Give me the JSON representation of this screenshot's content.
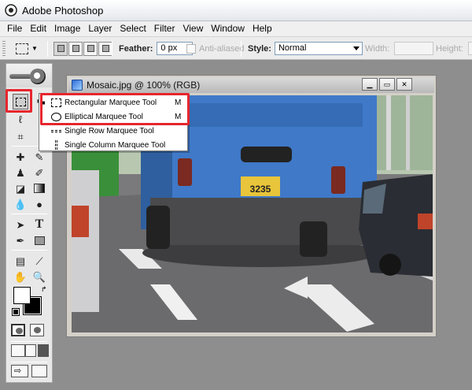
{
  "app": {
    "title": "Adobe Photoshop"
  },
  "menu": [
    "File",
    "Edit",
    "Image",
    "Layer",
    "Select",
    "Filter",
    "View",
    "Window",
    "Help"
  ],
  "options": {
    "feather_label": "Feather:",
    "feather_value": "0 px",
    "antialiased_label": "Anti-aliased",
    "style_label": "Style:",
    "style_value": "Normal",
    "width_label": "Width:",
    "height_label": "Height:"
  },
  "document": {
    "title": "Mosaic.jpg @ 100% (RGB)"
  },
  "flyout": {
    "items": [
      {
        "label": "Rectangular Marquee Tool",
        "shortcut": "M",
        "icon": "rectangular-marquee-icon"
      },
      {
        "label": "Elliptical Marquee Tool",
        "shortcut": "M",
        "icon": "elliptical-marquee-icon"
      },
      {
        "label": "Single Row Marquee Tool",
        "shortcut": "",
        "icon": "single-row-marquee-icon"
      },
      {
        "label": "Single Column Marquee Tool",
        "shortcut": "",
        "icon": "single-column-marquee-icon"
      }
    ]
  },
  "photo": {
    "plate_text": "3235"
  },
  "colors": {
    "highlight": "#e6262e",
    "bus": "#3f79c8",
    "road": "#6b6b6d"
  }
}
